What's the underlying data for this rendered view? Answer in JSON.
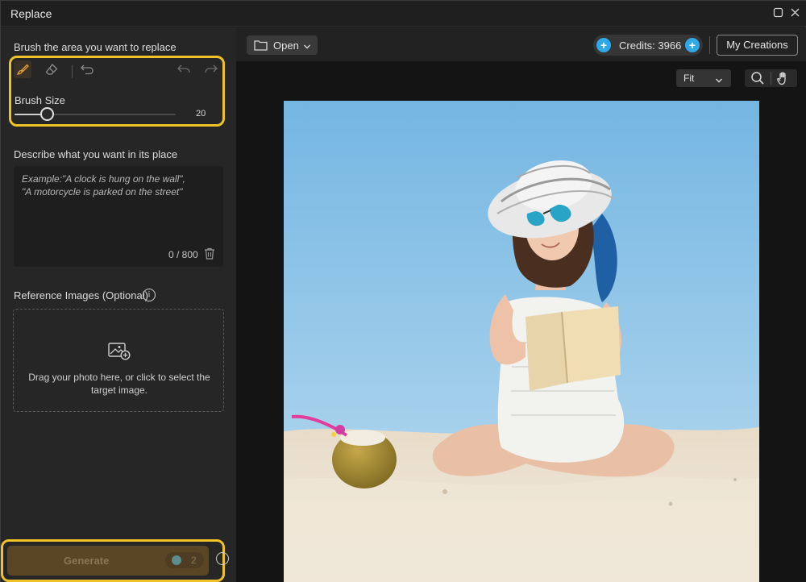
{
  "window": {
    "title": "Replace"
  },
  "left_panel": {
    "brush_section_label": "Brush the area you want to replace",
    "brush_size_label": "Brush Size",
    "brush_size_value": "20",
    "brush_size_fraction": 0.2,
    "describe_label": "Describe what you want in its place",
    "prompt_placeholder": "Example:\"A clock is hung on the wall\",\n\"A motorcycle is parked on the street\"",
    "prompt_value": "",
    "char_counter": "0 / 800",
    "reference_label": "Reference Images (Optional)",
    "reference_info": "i",
    "dropzone_text": "Drag your photo here, or click to select the target image.",
    "generate_label": "Generate",
    "generate_cost": "2"
  },
  "toolbar": {
    "open_label": "Open",
    "credits_text": "Credits: 3966",
    "my_creations_label": "My Creations",
    "fit_label": "Fit"
  },
  "colors": {
    "accent_highlight": "#f0c22a",
    "credit_blue": "#2ea8e8",
    "generate_bg": "#5a4524"
  },
  "icons": {
    "brush": "paint-brush-icon",
    "eraser": "eraser-icon",
    "reset": "reset-icon",
    "undo": "undo-icon",
    "redo": "redo-icon",
    "folder": "folder-icon",
    "search": "magnifier-icon",
    "hand": "hand-pan-icon",
    "image_add": "image-add-icon",
    "trash": "trash-icon"
  }
}
